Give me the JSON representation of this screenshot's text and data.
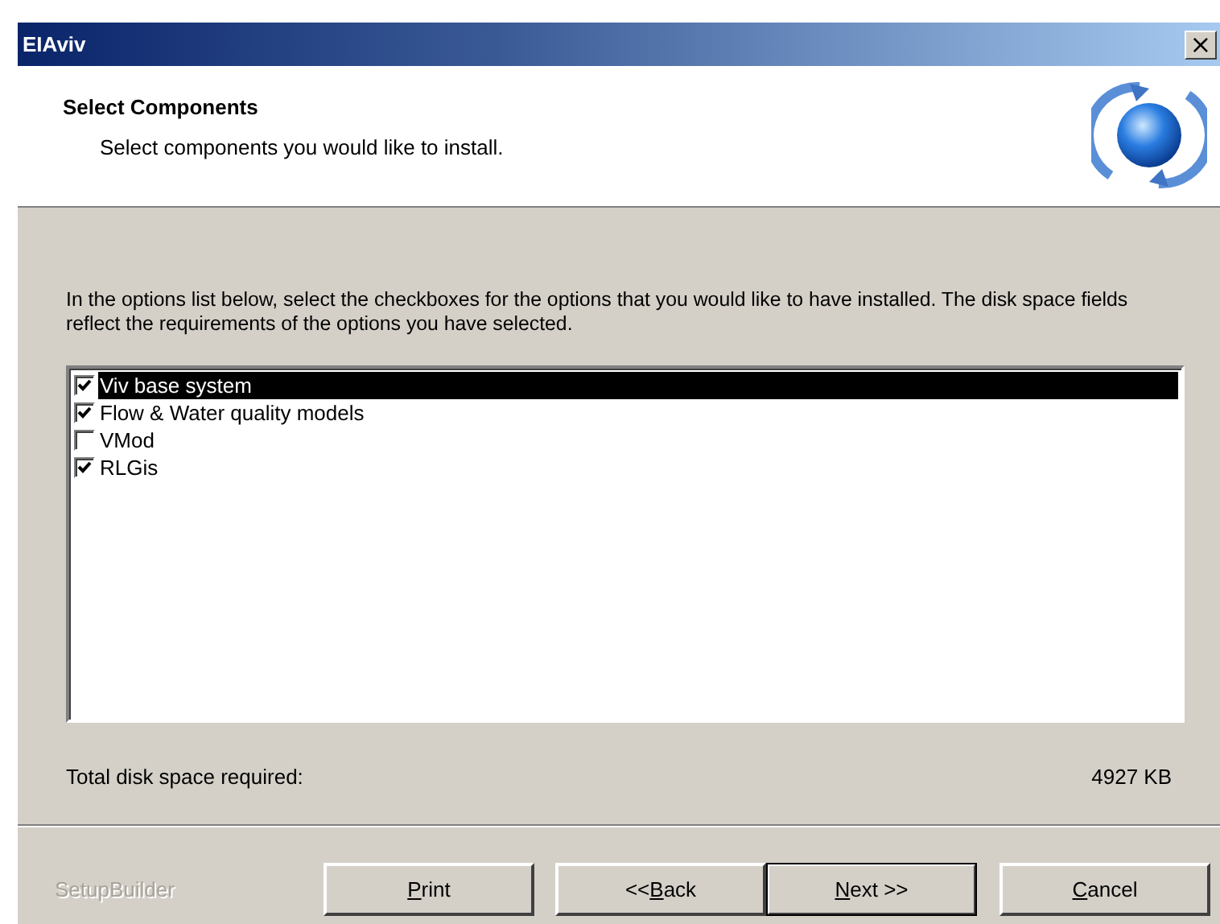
{
  "window": {
    "title": "EIAviv",
    "close": "×"
  },
  "header": {
    "title": "Select Components",
    "subtitle": "Select components you would like to install."
  },
  "instructions": "In the options list below, select the checkboxes for the options that you would like to have installed.  The disk space fields reflect the requirements of the options you have selected.",
  "components": [
    {
      "label": "Viv base system",
      "checked": true,
      "selected": true
    },
    {
      "label": "Flow & Water quality models",
      "checked": true,
      "selected": false
    },
    {
      "label": "VMod",
      "checked": false,
      "selected": false
    },
    {
      "label": "RLGis",
      "checked": true,
      "selected": false
    }
  ],
  "disk_space": {
    "label": "Total disk space required:",
    "value": "4927 KB"
  },
  "brand": "SetupBuilder",
  "buttons": [
    {
      "key": "P",
      "after": "rint",
      "default": false
    },
    {
      "before": "<<",
      "key": "B",
      "after": "ack",
      "default": false
    },
    {
      "key": "N",
      "after": "ext >>",
      "default": true
    },
    {
      "key": "C",
      "after": "ancel",
      "default": false
    }
  ]
}
